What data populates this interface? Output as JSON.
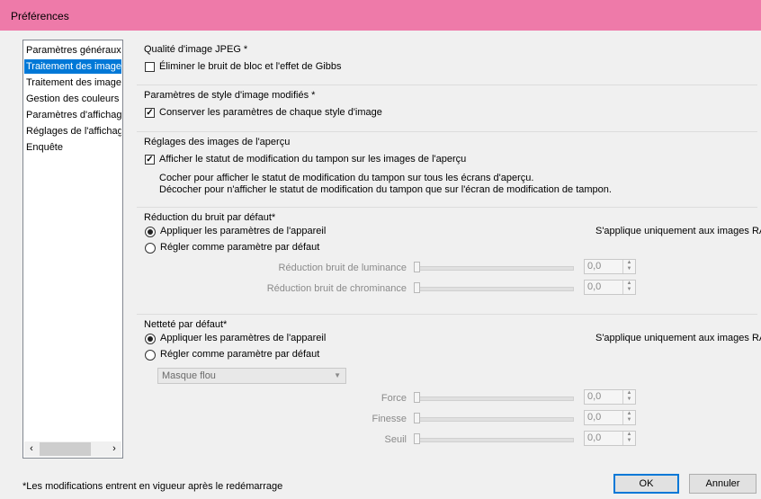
{
  "window": {
    "title": "Préférences"
  },
  "sidebar": {
    "items": [
      {
        "label": "Paramètres généraux",
        "selected": false
      },
      {
        "label": "Traitement des images",
        "selected": true
      },
      {
        "label": "Traitement des images",
        "selected": false
      },
      {
        "label": "Gestion des couleurs",
        "selected": false
      },
      {
        "label": "Paramètres d'affichage",
        "selected": false
      },
      {
        "label": "Réglages de l'affichage",
        "selected": false
      },
      {
        "label": "Enquête",
        "selected": false
      }
    ],
    "scroll_left_icon": "chevron-left-icon",
    "scroll_right_icon": "chevron-right-icon"
  },
  "jpeg_quality": {
    "title": "Qualité d'image JPEG *",
    "checkbox_label": "Éliminer le bruit de bloc et l'effet de Gibbs",
    "checked": false
  },
  "style_params": {
    "title": "Paramètres de style d'image modifiés *",
    "checkbox_label": "Conserver les paramètres de chaque style d'image",
    "checked": true
  },
  "preview": {
    "title": "Réglages des images de l'aperçu",
    "checkbox_label": "Afficher le statut de modification du tampon sur les images de l'aperçu",
    "checked": true,
    "desc_line1": "Cocher pour afficher le statut de modification du tampon sur tous les écrans d'aperçu.",
    "desc_line2": "Décocher pour n'afficher le statut de modification du tampon que sur l'écran de modification de tampon."
  },
  "noise": {
    "title": "Réduction du bruit par défaut*",
    "radio_apply": "Appliquer les paramètres de l'appareil",
    "radio_default": "Régler comme paramètre par défaut",
    "selected": "apply",
    "raw_note": "S'applique uniquement aux images RAW",
    "luminance_label": "Réduction bruit de luminance",
    "luminance_value": "0,0",
    "chrominance_label": "Réduction bruit de chrominance",
    "chrominance_value": "0,0"
  },
  "sharpness": {
    "title": "Netteté par défaut*",
    "radio_apply": "Appliquer les paramètres de l'appareil",
    "radio_default": "Régler comme paramètre par défaut",
    "selected": "apply",
    "raw_note": "S'applique uniquement aux images RAW",
    "mode_value": "Masque flou",
    "strength_label": "Force",
    "strength_value": "0,0",
    "fineness_label": "Finesse",
    "fineness_value": "0,0",
    "threshold_label": "Seuil",
    "threshold_value": "0,0"
  },
  "footer": {
    "note": "*Les modifications entrent en vigueur après le redémarrage",
    "ok_label": "OK",
    "cancel_label": "Annuler"
  },
  "colors": {
    "titlebar": "#ee7aa9",
    "selection": "#0078d7"
  }
}
